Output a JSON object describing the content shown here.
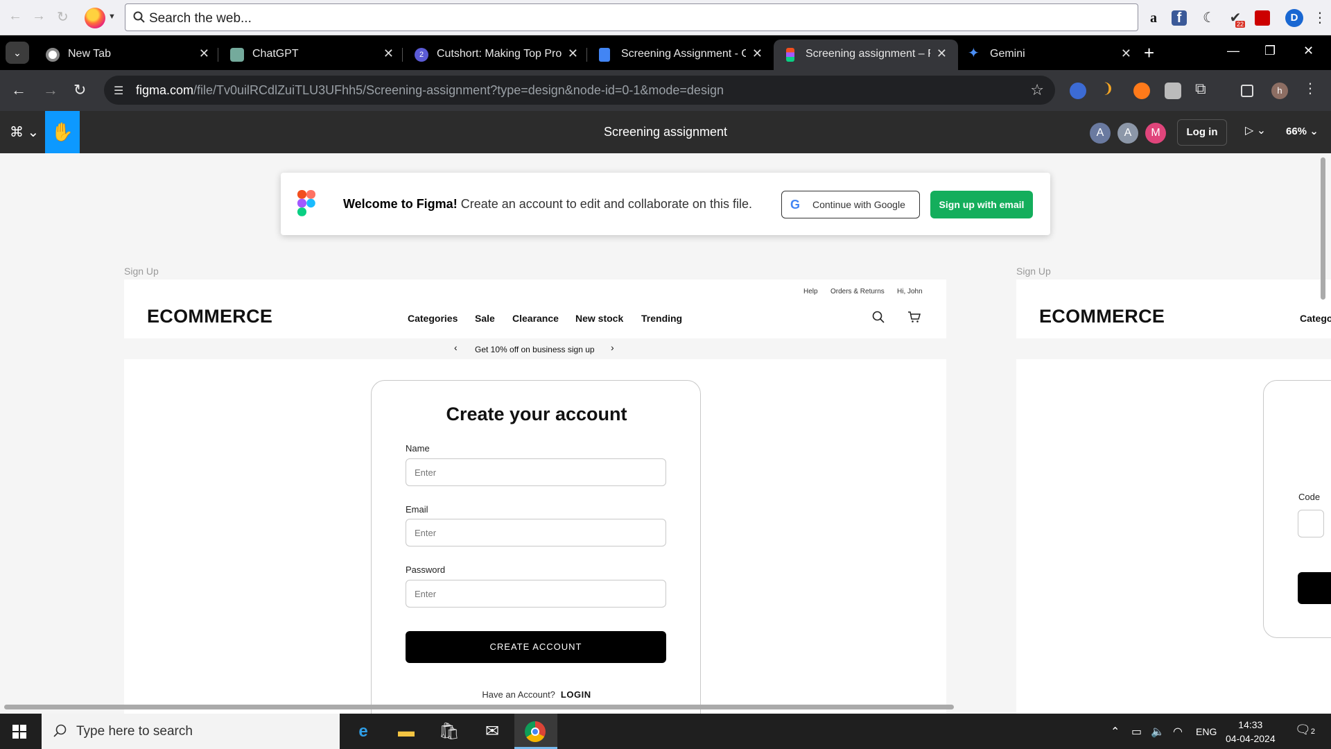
{
  "firefox": {
    "search_placeholder": "Search the web...",
    "ext_badge": "22"
  },
  "tabs": [
    {
      "title": "New Tab",
      "color": "#ffffff"
    },
    {
      "title": "ChatGPT",
      "color": "#74aa9c"
    },
    {
      "title": "Cutshort: Making Top Profi",
      "color": "#5b5bd6",
      "badge": "2"
    },
    {
      "title": "Screening Assignment - Go",
      "color": "#4285f4"
    },
    {
      "title": "Screening assignment – Fig",
      "color": "#f24e1e"
    },
    {
      "title": "Gemini",
      "color": "#4b8ef5"
    }
  ],
  "address": {
    "host": "figma.com",
    "path": "/file/Tv0uilRCdlZuiTLU3UFhh5/Screening-assignment?type=design&node-id=0-1&mode=design"
  },
  "figma": {
    "file_title": "Screening assignment",
    "avatars": [
      {
        "letter": "A",
        "color": "#6a7aa0"
      },
      {
        "letter": "A",
        "color": "#8c97a8"
      },
      {
        "letter": "M",
        "color": "#e0457b"
      }
    ],
    "login_label": "Log in",
    "zoom": "66%"
  },
  "welcome": {
    "bold": "Welcome to Figma!",
    "text": " Create an account to edit and collaborate on this file.",
    "google_btn": "Continue with Google",
    "email_btn": "Sign up with email"
  },
  "frame1": {
    "label": "Sign Up",
    "top_links": [
      "Help",
      "Orders & Returns",
      "Hi, John"
    ],
    "brand": "ECOMMERCE",
    "nav": [
      "Categories",
      "Sale",
      "Clearance",
      "New stock",
      "Trending"
    ],
    "promo": "Get 10% off on business sign up",
    "form": {
      "title": "Create your account",
      "name_label": "Name",
      "email_label": "Email",
      "password_label": "Password",
      "placeholder": "Enter",
      "create_btn": "CREATE ACCOUNT",
      "have_account": "Have an Account?",
      "login_link": "LOGIN"
    }
  },
  "frame2": {
    "label": "Sign Up",
    "brand": "ECOMMERCE",
    "nav_partial": "Catego",
    "code_label": "Code"
  },
  "taskbar": {
    "search_text": "Type here to search",
    "lang": "ENG",
    "time": "14:33",
    "date": "04-04-2024",
    "notif_count": "2"
  }
}
